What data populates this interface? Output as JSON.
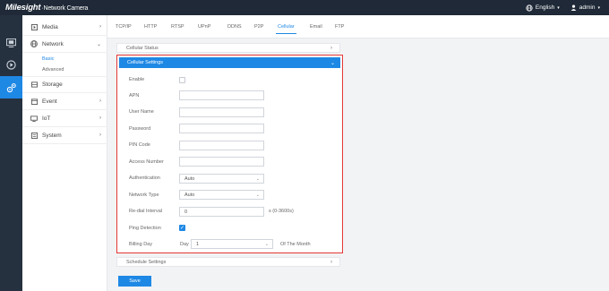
{
  "header": {
    "brand": "Milesight",
    "product": "·Network Camera",
    "language": "English",
    "user": "admin"
  },
  "sidebar": {
    "items": [
      {
        "label": "Media",
        "icon": "media-icon"
      },
      {
        "label": "Network",
        "icon": "network-icon"
      },
      {
        "label": "Storage",
        "icon": "storage-icon"
      },
      {
        "label": "Event",
        "icon": "event-icon"
      },
      {
        "label": "IoT",
        "icon": "iot-icon"
      },
      {
        "label": "System",
        "icon": "system-icon"
      }
    ],
    "network_sub": [
      {
        "label": "Basic",
        "active": true
      },
      {
        "label": "Advanced",
        "active": false
      }
    ]
  },
  "tabs": [
    "TCP/IP",
    "HTTP",
    "RTSP",
    "UPnP",
    "DDNS",
    "P2P",
    "Cellular",
    "Email",
    "FTP"
  ],
  "active_tab": "Cellular",
  "sections": {
    "cellular_status": "Cellular Status",
    "cellular_settings": "Cellular Settings",
    "schedule_settings": "Schedule Settings"
  },
  "form": {
    "enable_label": "Enable",
    "enable_checked": false,
    "apn_label": "APN",
    "apn_value": "",
    "username_label": "User Name",
    "username_value": "",
    "password_label": "Password",
    "password_value": "",
    "pin_label": "PIN Code",
    "pin_value": "",
    "access_number_label": "Access Number",
    "access_number_value": "",
    "authentication_label": "Authentication",
    "authentication_value": "Auto",
    "network_type_label": "Network Type",
    "network_type_value": "Auto",
    "redial_label": "Re-dial Interval",
    "redial_value": "0",
    "redial_unit": "s (0-3600s)",
    "ping_label": "Ping Detection",
    "ping_checked": true,
    "billing_label": "Billing Day",
    "billing_prefix": "Day",
    "billing_value": "1",
    "billing_suffix": "Of The Month"
  },
  "buttons": {
    "save": "Save"
  },
  "colors": {
    "accent": "#1e88e5",
    "highlight_border": "#e53935",
    "topbar": "#1f2937"
  }
}
